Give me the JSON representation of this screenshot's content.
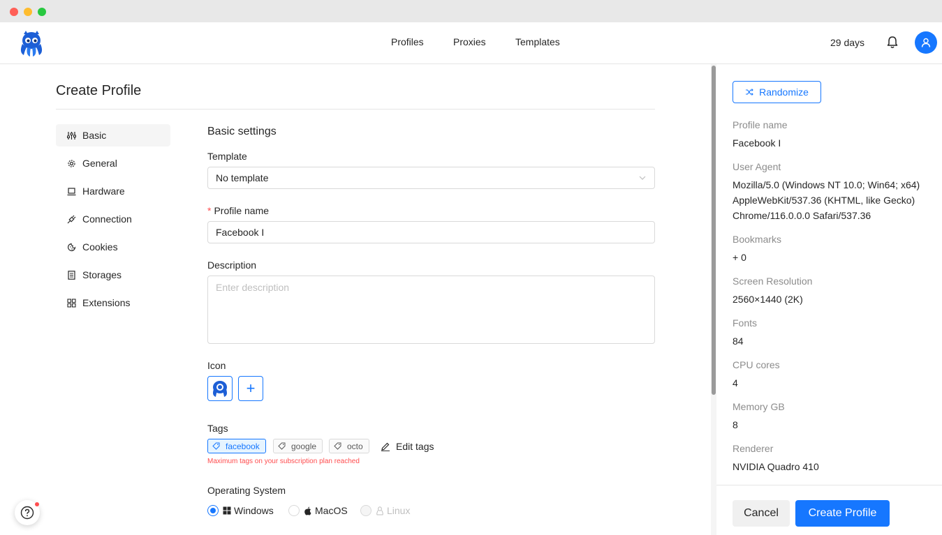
{
  "nav": {
    "links": [
      "Profiles",
      "Proxies",
      "Templates"
    ],
    "days_left": "29 days"
  },
  "page": {
    "title": "Create Profile"
  },
  "sidebar": {
    "items": [
      {
        "label": "Basic",
        "icon": "sliders-icon"
      },
      {
        "label": "General",
        "icon": "gear-icon"
      },
      {
        "label": "Hardware",
        "icon": "laptop-icon"
      },
      {
        "label": "Connection",
        "icon": "plug-icon"
      },
      {
        "label": "Cookies",
        "icon": "cookie-icon"
      },
      {
        "label": "Storages",
        "icon": "storage-icon"
      },
      {
        "label": "Extensions",
        "icon": "grid-icon"
      }
    ]
  },
  "form": {
    "section_title": "Basic settings",
    "template_label": "Template",
    "template_value": "No template",
    "profile_name_label": "Profile name",
    "profile_name_value": "Facebook I",
    "description_label": "Description",
    "description_placeholder": "Enter description",
    "icon_label": "Icon",
    "add_icon_symbol": "+",
    "tags_label": "Tags",
    "tags": [
      "facebook",
      "google",
      "octo"
    ],
    "edit_tags_label": "Edit tags",
    "tags_warning": "Maximum tags on your subscription plan reached",
    "os_label": "Operating System",
    "os_options": [
      "Windows",
      "MacOS",
      "Linux"
    ],
    "os_selected": "Windows"
  },
  "summary": {
    "randomize_label": "Randomize",
    "fields": [
      {
        "label": "Profile name",
        "value": "Facebook I"
      },
      {
        "label": "User Agent",
        "value": "Mozilla/5.0 (Windows NT 10.0; Win64; x64) AppleWebKit/537.36 (KHTML, like Gecko) Chrome/116.0.0.0 Safari/537.36"
      },
      {
        "label": "Bookmarks",
        "value": "+ 0"
      },
      {
        "label": "Screen Resolution",
        "value": "2560×1440 (2K)"
      },
      {
        "label": "Fonts",
        "value": "84"
      },
      {
        "label": "CPU cores",
        "value": "4"
      },
      {
        "label": "Memory GB",
        "value": "8"
      },
      {
        "label": "Renderer",
        "value": "NVIDIA Quadro 410"
      }
    ],
    "cancel_label": "Cancel",
    "create_label": "Create Profile"
  },
  "colors": {
    "accent": "#1677ff",
    "error": "#ff4d4f"
  }
}
